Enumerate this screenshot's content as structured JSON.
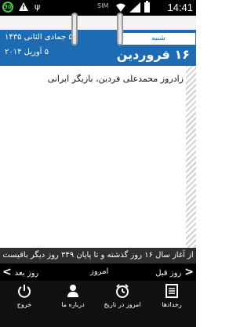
{
  "status_bar": {
    "badge": "30",
    "sim_label": "SIM",
    "time": "14:41"
  },
  "calendar": {
    "hijri_date": "۵ جمادی الثانی ۱۴۳۵",
    "gregorian_date": "۵ آوریل ۲۰۱۴",
    "weekday": "شنبه",
    "solar_date": "۱۶ فروردین",
    "event": "زادروز محمدعلی فردین، بازیگر ایرانی"
  },
  "info": {
    "text": "از آغاز سال ۱۶ روز گذشته و تا پایان ۳۴۹ روز دیگر باقیست"
  },
  "nav": {
    "next_label": "روز بعد",
    "today_label": "امروز",
    "prev_label": "روز قبل"
  },
  "actions": [
    {
      "label": "خروج",
      "icon": "power-icon"
    },
    {
      "label": "درباره ما",
      "icon": "person-icon"
    },
    {
      "label": "امروز در تاریخ",
      "icon": "clock-icon"
    },
    {
      "label": "رخدادها",
      "icon": "list-icon"
    }
  ],
  "colors": {
    "header_blue": "#1d6bb3",
    "status_green": "#3fd23f"
  }
}
